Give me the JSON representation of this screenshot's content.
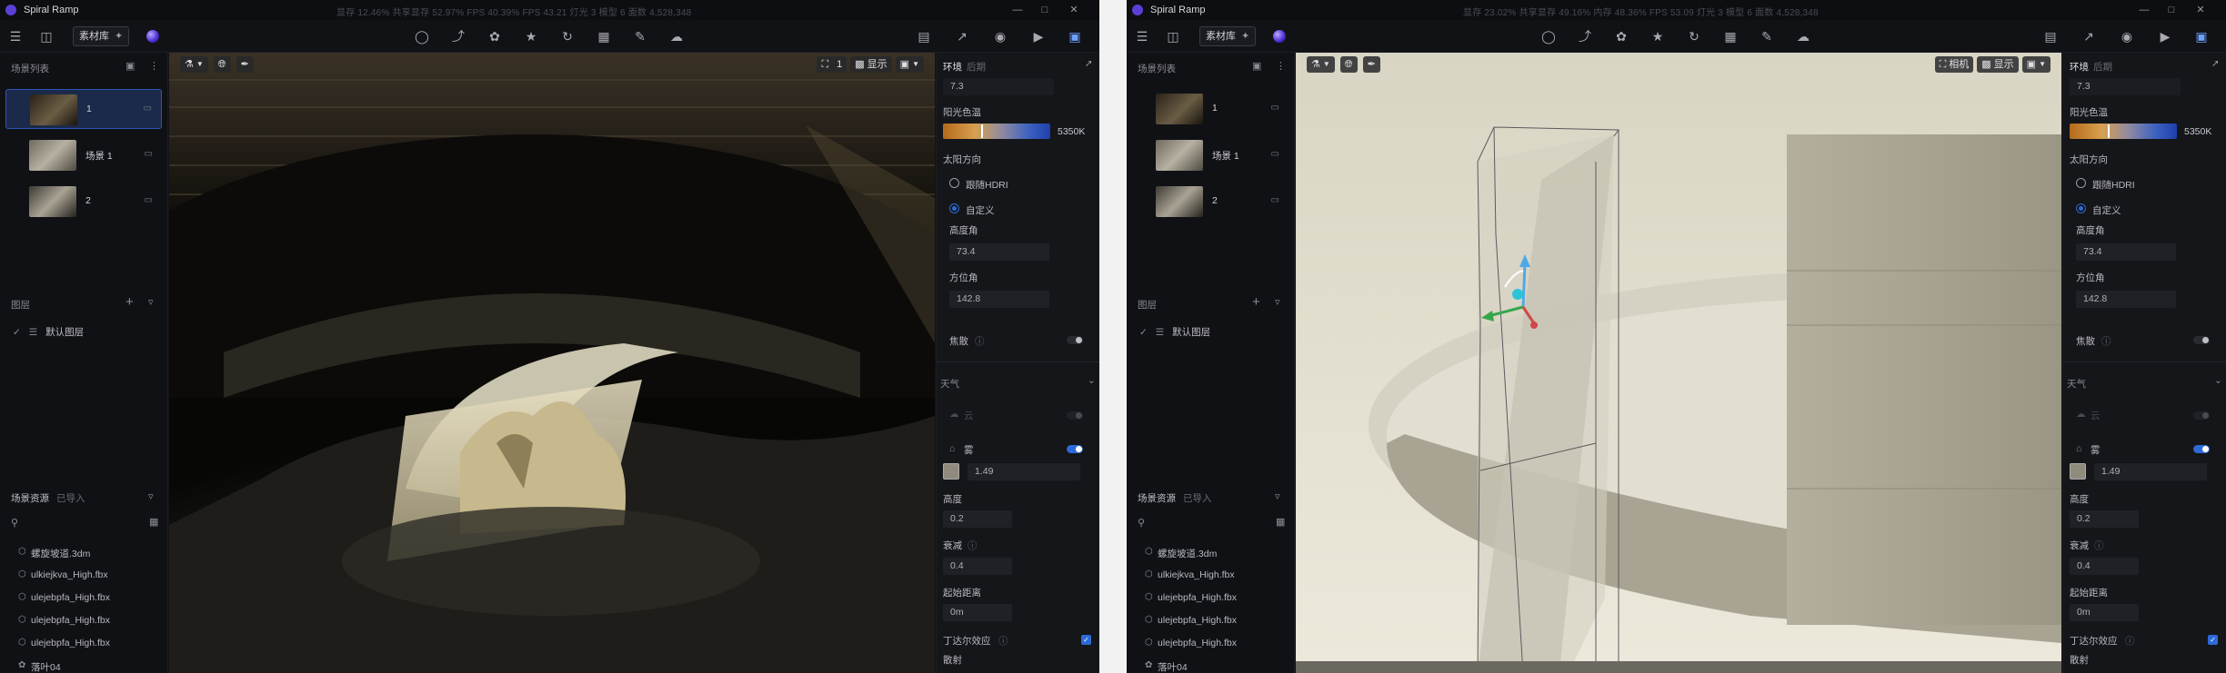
{
  "windows": [
    {
      "title": "Spiral Ramp",
      "stats": "显存 12.46%    共享显存 52.97%    FPS 40.39%    FPS 43.21    灯光 3    模型 6    面数 4,528,348",
      "toolbar": {
        "library_label": "素材库"
      },
      "sidebar": {
        "scenes_title": "场景列表",
        "scenes": [
          {
            "label": "1",
            "selected": true
          },
          {
            "label": "场景 1",
            "selected": false
          },
          {
            "label": "2",
            "selected": false
          }
        ],
        "layers_title": "图层",
        "layers": [
          {
            "label": "默认图层"
          }
        ],
        "assets_tab_active": "场景资源",
        "assets_tab_inactive": "已导入",
        "assets": [
          "螺旋坡道.3dm",
          "ulkiejkva_High.fbx",
          "ulejebpfa_High.fbx",
          "ulejebpfa_High.fbx",
          "ulejebpfa_High.fbx",
          "落叶04"
        ]
      },
      "viewport": {
        "count_label": "1",
        "display_label": "显示"
      },
      "panel": {
        "tab_env": "环境",
        "tab_post": "后期",
        "top_value": "7.3",
        "sun_color_label": "阳光色温",
        "sun_color_value": "5350K",
        "sun_dir_label": "太阳方向",
        "follow_hdri_label": "跟随HDRI",
        "custom_label": "自定义",
        "altitude_label": "高度角",
        "altitude_value": "73.4",
        "azimuth_label": "方位角",
        "azimuth_value": "142.8",
        "focus_label": "焦散",
        "weather_title": "天气",
        "cloud_label": "云",
        "fog_label": "雾",
        "fog_value": "1.49",
        "height_label": "高度",
        "height_value": "0.2",
        "falloff_label": "衰减",
        "falloff_value": "0.4",
        "start_distance_label": "起始距离",
        "start_distance_value": "0m",
        "tyndall_label": "丁达尔效应",
        "scatter_label": "散射"
      }
    },
    {
      "title": "Spiral Ramp",
      "stats": "显存 23.02%    共享显存 49.16%    内存 48.36%    FPS 53.09    灯光 3    模型 6    面数 4,528,348",
      "toolbar": {
        "library_label": "素材库"
      },
      "sidebar": {
        "scenes_title": "场景列表",
        "scenes": [
          {
            "label": "1",
            "selected": false
          },
          {
            "label": "场景 1",
            "selected": false
          },
          {
            "label": "2",
            "selected": false
          }
        ],
        "layers_title": "图层",
        "layers": [
          {
            "label": "默认图层"
          }
        ],
        "assets_tab_active": "场景资源",
        "assets_tab_inactive": "已导入",
        "assets": [
          "螺旋坡道.3dm",
          "ulkiejkva_High.fbx",
          "ulejebpfa_High.fbx",
          "ulejebpfa_High.fbx",
          "ulejebpfa_High.fbx",
          "落叶04"
        ]
      },
      "viewport": {
        "camera_label": "相机",
        "display_label": "显示"
      },
      "panel": {
        "tab_env": "环境",
        "tab_post": "后期",
        "top_value": "7.3",
        "sun_color_label": "阳光色温",
        "sun_color_value": "5350K",
        "sun_dir_label": "太阳方向",
        "follow_hdri_label": "跟随HDRI",
        "custom_label": "自定义",
        "altitude_label": "高度角",
        "altitude_value": "73.4",
        "azimuth_label": "方位角",
        "azimuth_value": "142.8",
        "focus_label": "焦散",
        "weather_title": "天气",
        "cloud_label": "云",
        "fog_label": "雾",
        "fog_value": "1.49",
        "height_label": "高度",
        "height_value": "0.2",
        "falloff_label": "衰减",
        "falloff_value": "0.4",
        "start_distance_label": "起始距离",
        "start_distance_value": "0m",
        "tyndall_label": "丁达尔效应",
        "scatter_label": "散射"
      }
    }
  ],
  "colors": {
    "accent": "#2d6ad6",
    "selected_bg": "#1b2a4a",
    "fog_swatch": "#8f8a7c"
  },
  "icons": [
    "menu-icon",
    "file-icon",
    "magic-icon",
    "light-bulb-icon",
    "measure-icon",
    "leaf-icon",
    "flame-icon",
    "rotate-icon",
    "grid-icon",
    "brush-icon",
    "cloud-icon",
    "car-icon",
    "share-icon",
    "camera-icon",
    "video-icon",
    "save-icon"
  ]
}
